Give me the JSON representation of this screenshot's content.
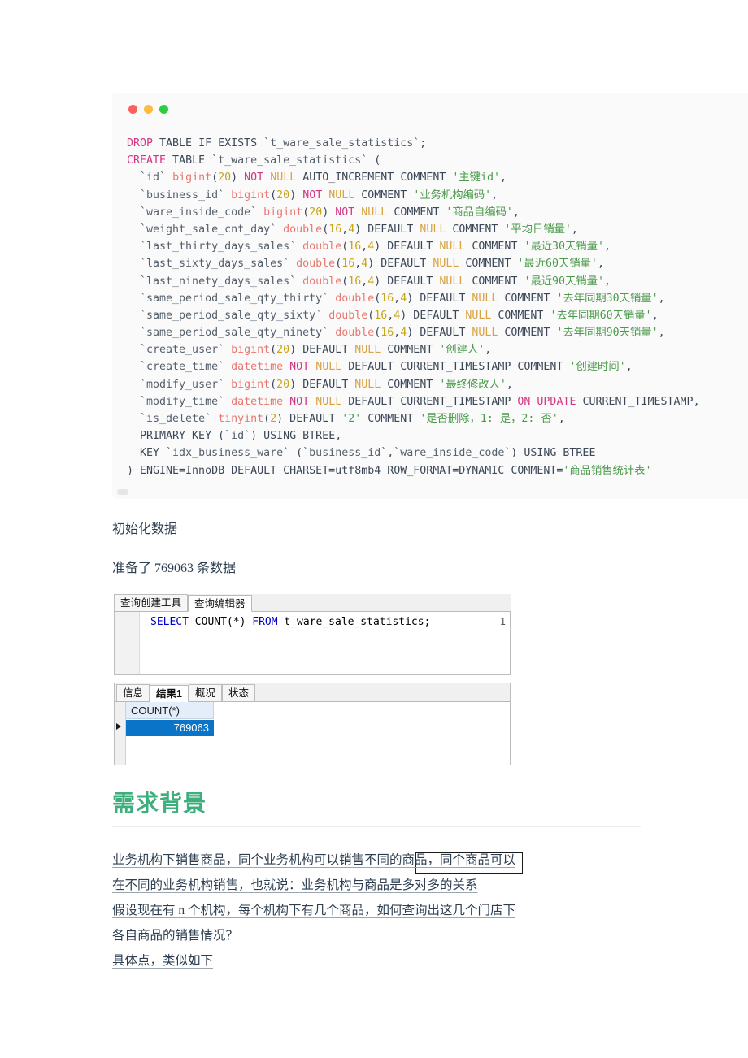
{
  "code_block": {
    "window_dots": [
      "close-red",
      "minimize-yellow",
      "maximize-green"
    ],
    "language": "sql",
    "lines": [
      [
        {
          "t": "DROP",
          "c": "k"
        },
        {
          "t": " TABLE IF EXISTS ",
          "c": "kw"
        },
        {
          "t": "`t_ware_sale_statistics`",
          "c": "id"
        },
        {
          "t": ";",
          "c": "kw"
        }
      ],
      [
        {
          "t": "CREATE",
          "c": "k"
        },
        {
          "t": " TABLE ",
          "c": "kw"
        },
        {
          "t": "`t_ware_sale_statistics`",
          "c": "id"
        },
        {
          "t": " (",
          "c": "kw"
        }
      ],
      [
        {
          "t": "  ",
          "c": "kw"
        },
        {
          "t": "`id`",
          "c": "id"
        },
        {
          "t": " ",
          "c": "kw"
        },
        {
          "t": "bigint",
          "c": "typ"
        },
        {
          "t": "(",
          "c": "kw"
        },
        {
          "t": "20",
          "c": "num"
        },
        {
          "t": ") ",
          "c": "kw"
        },
        {
          "t": "NOT",
          "c": "k"
        },
        {
          "t": " ",
          "c": "kw"
        },
        {
          "t": "NULL",
          "c": "nul"
        },
        {
          "t": " AUTO_INCREMENT COMMENT ",
          "c": "kw"
        },
        {
          "t": "'主键id'",
          "c": "str"
        },
        {
          "t": ",",
          "c": "kw"
        }
      ],
      [
        {
          "t": "  ",
          "c": "kw"
        },
        {
          "t": "`business_id`",
          "c": "id"
        },
        {
          "t": " ",
          "c": "kw"
        },
        {
          "t": "bigint",
          "c": "typ"
        },
        {
          "t": "(",
          "c": "kw"
        },
        {
          "t": "20",
          "c": "num"
        },
        {
          "t": ") ",
          "c": "kw"
        },
        {
          "t": "NOT",
          "c": "k"
        },
        {
          "t": " ",
          "c": "kw"
        },
        {
          "t": "NULL",
          "c": "nul"
        },
        {
          "t": " COMMENT ",
          "c": "kw"
        },
        {
          "t": "'业务机构编码'",
          "c": "str"
        },
        {
          "t": ",",
          "c": "kw"
        }
      ],
      [
        {
          "t": "  ",
          "c": "kw"
        },
        {
          "t": "`ware_inside_code`",
          "c": "id"
        },
        {
          "t": " ",
          "c": "kw"
        },
        {
          "t": "bigint",
          "c": "typ"
        },
        {
          "t": "(",
          "c": "kw"
        },
        {
          "t": "20",
          "c": "num"
        },
        {
          "t": ") ",
          "c": "kw"
        },
        {
          "t": "NOT",
          "c": "k"
        },
        {
          "t": " ",
          "c": "kw"
        },
        {
          "t": "NULL",
          "c": "nul"
        },
        {
          "t": " COMMENT ",
          "c": "kw"
        },
        {
          "t": "'商品自编码'",
          "c": "str"
        },
        {
          "t": ",",
          "c": "kw"
        }
      ],
      [
        {
          "t": "  ",
          "c": "kw"
        },
        {
          "t": "`weight_sale_cnt_day`",
          "c": "id"
        },
        {
          "t": " ",
          "c": "kw"
        },
        {
          "t": "double",
          "c": "typ"
        },
        {
          "t": "(",
          "c": "kw"
        },
        {
          "t": "16",
          "c": "num"
        },
        {
          "t": ",",
          "c": "kw"
        },
        {
          "t": "4",
          "c": "num"
        },
        {
          "t": ") DEFAULT ",
          "c": "kw"
        },
        {
          "t": "NULL",
          "c": "nul"
        },
        {
          "t": " COMMENT ",
          "c": "kw"
        },
        {
          "t": "'平均日销量'",
          "c": "str"
        },
        {
          "t": ",",
          "c": "kw"
        }
      ],
      [
        {
          "t": "  ",
          "c": "kw"
        },
        {
          "t": "`last_thirty_days_sales`",
          "c": "id"
        },
        {
          "t": " ",
          "c": "kw"
        },
        {
          "t": "double",
          "c": "typ"
        },
        {
          "t": "(",
          "c": "kw"
        },
        {
          "t": "16",
          "c": "num"
        },
        {
          "t": ",",
          "c": "kw"
        },
        {
          "t": "4",
          "c": "num"
        },
        {
          "t": ") DEFAULT ",
          "c": "kw"
        },
        {
          "t": "NULL",
          "c": "nul"
        },
        {
          "t": " COMMENT ",
          "c": "kw"
        },
        {
          "t": "'最近30天销量'",
          "c": "str"
        },
        {
          "t": ",",
          "c": "kw"
        }
      ],
      [
        {
          "t": "  ",
          "c": "kw"
        },
        {
          "t": "`last_sixty_days_sales`",
          "c": "id"
        },
        {
          "t": " ",
          "c": "kw"
        },
        {
          "t": "double",
          "c": "typ"
        },
        {
          "t": "(",
          "c": "kw"
        },
        {
          "t": "16",
          "c": "num"
        },
        {
          "t": ",",
          "c": "kw"
        },
        {
          "t": "4",
          "c": "num"
        },
        {
          "t": ") DEFAULT ",
          "c": "kw"
        },
        {
          "t": "NULL",
          "c": "nul"
        },
        {
          "t": " COMMENT ",
          "c": "kw"
        },
        {
          "t": "'最近60天销量'",
          "c": "str"
        },
        {
          "t": ",",
          "c": "kw"
        }
      ],
      [
        {
          "t": "  ",
          "c": "kw"
        },
        {
          "t": "`last_ninety_days_sales`",
          "c": "id"
        },
        {
          "t": " ",
          "c": "kw"
        },
        {
          "t": "double",
          "c": "typ"
        },
        {
          "t": "(",
          "c": "kw"
        },
        {
          "t": "16",
          "c": "num"
        },
        {
          "t": ",",
          "c": "kw"
        },
        {
          "t": "4",
          "c": "num"
        },
        {
          "t": ") DEFAULT ",
          "c": "kw"
        },
        {
          "t": "NULL",
          "c": "nul"
        },
        {
          "t": " COMMENT ",
          "c": "kw"
        },
        {
          "t": "'最近90天销量'",
          "c": "str"
        },
        {
          "t": ",",
          "c": "kw"
        }
      ],
      [
        {
          "t": "  ",
          "c": "kw"
        },
        {
          "t": "`same_period_sale_qty_thirty`",
          "c": "id"
        },
        {
          "t": " ",
          "c": "kw"
        },
        {
          "t": "double",
          "c": "typ"
        },
        {
          "t": "(",
          "c": "kw"
        },
        {
          "t": "16",
          "c": "num"
        },
        {
          "t": ",",
          "c": "kw"
        },
        {
          "t": "4",
          "c": "num"
        },
        {
          "t": ") DEFAULT ",
          "c": "kw"
        },
        {
          "t": "NULL",
          "c": "nul"
        },
        {
          "t": " COMMENT ",
          "c": "kw"
        },
        {
          "t": "'去年同期30天销量'",
          "c": "str"
        },
        {
          "t": ",",
          "c": "kw"
        }
      ],
      [
        {
          "t": "  ",
          "c": "kw"
        },
        {
          "t": "`same_period_sale_qty_sixty`",
          "c": "id"
        },
        {
          "t": " ",
          "c": "kw"
        },
        {
          "t": "double",
          "c": "typ"
        },
        {
          "t": "(",
          "c": "kw"
        },
        {
          "t": "16",
          "c": "num"
        },
        {
          "t": ",",
          "c": "kw"
        },
        {
          "t": "4",
          "c": "num"
        },
        {
          "t": ") DEFAULT ",
          "c": "kw"
        },
        {
          "t": "NULL",
          "c": "nul"
        },
        {
          "t": " COMMENT ",
          "c": "kw"
        },
        {
          "t": "'去年同期60天销量'",
          "c": "str"
        },
        {
          "t": ",",
          "c": "kw"
        }
      ],
      [
        {
          "t": "  ",
          "c": "kw"
        },
        {
          "t": "`same_period_sale_qty_ninety`",
          "c": "id"
        },
        {
          "t": " ",
          "c": "kw"
        },
        {
          "t": "double",
          "c": "typ"
        },
        {
          "t": "(",
          "c": "kw"
        },
        {
          "t": "16",
          "c": "num"
        },
        {
          "t": ",",
          "c": "kw"
        },
        {
          "t": "4",
          "c": "num"
        },
        {
          "t": ") DEFAULT ",
          "c": "kw"
        },
        {
          "t": "NULL",
          "c": "nul"
        },
        {
          "t": " COMMENT ",
          "c": "kw"
        },
        {
          "t": "'去年同期90天销量'",
          "c": "str"
        },
        {
          "t": ",",
          "c": "kw"
        }
      ],
      [
        {
          "t": "  ",
          "c": "kw"
        },
        {
          "t": "`create_user`",
          "c": "id"
        },
        {
          "t": " ",
          "c": "kw"
        },
        {
          "t": "bigint",
          "c": "typ"
        },
        {
          "t": "(",
          "c": "kw"
        },
        {
          "t": "20",
          "c": "num"
        },
        {
          "t": ") DEFAULT ",
          "c": "kw"
        },
        {
          "t": "NULL",
          "c": "nul"
        },
        {
          "t": " COMMENT ",
          "c": "kw"
        },
        {
          "t": "'创建人'",
          "c": "str"
        },
        {
          "t": ",",
          "c": "kw"
        }
      ],
      [
        {
          "t": "  ",
          "c": "kw"
        },
        {
          "t": "`create_time`",
          "c": "id"
        },
        {
          "t": " ",
          "c": "kw"
        },
        {
          "t": "datetime",
          "c": "typ"
        },
        {
          "t": " ",
          "c": "kw"
        },
        {
          "t": "NOT",
          "c": "k"
        },
        {
          "t": " ",
          "c": "kw"
        },
        {
          "t": "NULL",
          "c": "nul"
        },
        {
          "t": " DEFAULT CURRENT_TIMESTAMP COMMENT ",
          "c": "kw"
        },
        {
          "t": "'创建时间'",
          "c": "str"
        },
        {
          "t": ",",
          "c": "kw"
        }
      ],
      [
        {
          "t": "  ",
          "c": "kw"
        },
        {
          "t": "`modify_user`",
          "c": "id"
        },
        {
          "t": " ",
          "c": "kw"
        },
        {
          "t": "bigint",
          "c": "typ"
        },
        {
          "t": "(",
          "c": "kw"
        },
        {
          "t": "20",
          "c": "num"
        },
        {
          "t": ") DEFAULT ",
          "c": "kw"
        },
        {
          "t": "NULL",
          "c": "nul"
        },
        {
          "t": " COMMENT ",
          "c": "kw"
        },
        {
          "t": "'最终修改人'",
          "c": "str"
        },
        {
          "t": ",",
          "c": "kw"
        }
      ],
      [
        {
          "t": "  ",
          "c": "kw"
        },
        {
          "t": "`modify_time`",
          "c": "id"
        },
        {
          "t": " ",
          "c": "kw"
        },
        {
          "t": "datetime",
          "c": "typ"
        },
        {
          "t": " ",
          "c": "kw"
        },
        {
          "t": "NOT",
          "c": "k"
        },
        {
          "t": " ",
          "c": "kw"
        },
        {
          "t": "NULL",
          "c": "nul"
        },
        {
          "t": " DEFAULT CURRENT_TIMESTAMP ",
          "c": "kw"
        },
        {
          "t": "ON UPDATE",
          "c": "k"
        },
        {
          "t": " CURRENT_TIMESTAMP,",
          "c": "kw"
        }
      ],
      [
        {
          "t": "  ",
          "c": "kw"
        },
        {
          "t": "`is_delete`",
          "c": "id"
        },
        {
          "t": " ",
          "c": "kw"
        },
        {
          "t": "tinyint",
          "c": "typ"
        },
        {
          "t": "(",
          "c": "kw"
        },
        {
          "t": "2",
          "c": "num"
        },
        {
          "t": ") DEFAULT ",
          "c": "kw"
        },
        {
          "t": "'2'",
          "c": "str"
        },
        {
          "t": " COMMENT ",
          "c": "kw"
        },
        {
          "t": "'是否删除，1: 是，2: 否'",
          "c": "str"
        },
        {
          "t": ",",
          "c": "kw"
        }
      ],
      [
        {
          "t": "  PRIMARY KEY (",
          "c": "kw"
        },
        {
          "t": "`id`",
          "c": "id"
        },
        {
          "t": ") USING BTREE,",
          "c": "kw"
        }
      ],
      [
        {
          "t": "  KEY ",
          "c": "kw"
        },
        {
          "t": "`idx_business_ware`",
          "c": "id"
        },
        {
          "t": " (",
          "c": "kw"
        },
        {
          "t": "`business_id`",
          "c": "id"
        },
        {
          "t": ",",
          "c": "kw"
        },
        {
          "t": "`ware_inside_code`",
          "c": "id"
        },
        {
          "t": ") USING BTREE",
          "c": "kw"
        }
      ],
      [
        {
          "t": ") ENGINE=InnoDB DEFAULT CHARSET=utf8mb4 ROW_FORMAT=DYNAMIC COMMENT=",
          "c": "kw"
        },
        {
          "t": "'商品销售统计表'",
          "c": "str"
        }
      ]
    ]
  },
  "paragraphs": {
    "init_data": "初始化数据",
    "row_count_text": "准备了 769063 条数据"
  },
  "navicat": {
    "top_tabs": [
      {
        "label": "查询创建工具",
        "active": false
      },
      {
        "label": "查询编辑器",
        "active": true
      }
    ],
    "editor": {
      "line_number": "1",
      "sql_parts": [
        {
          "t": "SELECT",
          "kw": true
        },
        {
          "t": " COUNT(*) ",
          "kw": false
        },
        {
          "t": "FROM",
          "kw": true
        },
        {
          "t": " t_ware_sale_statistics;",
          "kw": false
        }
      ]
    },
    "result_tabs": [
      {
        "label": "信息",
        "active": false
      },
      {
        "label": "结果1",
        "active": true
      },
      {
        "label": "概况",
        "active": false
      },
      {
        "label": "状态",
        "active": false
      }
    ],
    "grid": {
      "column_header": "COUNT(*)",
      "cell_value": "769063"
    }
  },
  "section": {
    "heading": "需求背景",
    "heading_color": "#3eaf7c",
    "body_lines": [
      "业务机构下销售商品，同个业务机构可以销售不同的商品，同个商品可以",
      "在不同的业务机构销售，也就说：业务机构与商品是多对多的关系",
      "假设现在有 n 个机构，每个机构下有几个商品，如何查询出这几个门店下",
      "各自商品的销售情况？",
      "具体点，类似如下"
    ]
  }
}
